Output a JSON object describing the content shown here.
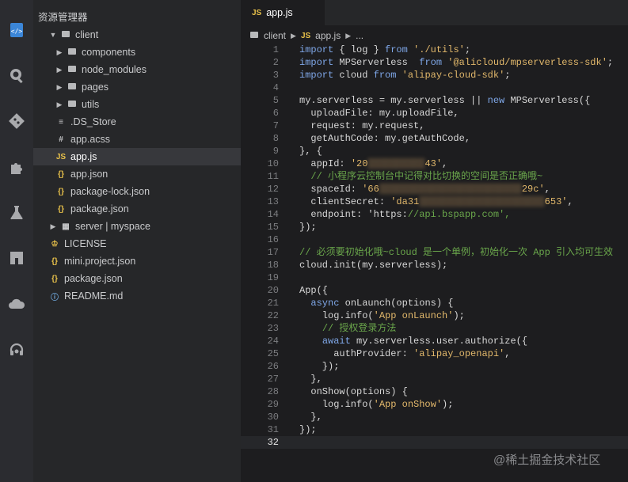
{
  "activity_bar": {
    "icons": [
      "code-icon",
      "search-icon",
      "git-icon",
      "extensions-icon",
      "test-flask-icon",
      "layout-icon",
      "cloud-icon",
      "support-headset-icon"
    ]
  },
  "explorer": {
    "title": "资源管理器",
    "items": [
      {
        "label": "client",
        "type": "folder-open"
      },
      {
        "label": "components",
        "type": "folder"
      },
      {
        "label": "node_modules",
        "type": "folder"
      },
      {
        "label": "pages",
        "type": "folder"
      },
      {
        "label": "utils",
        "type": "folder"
      },
      {
        "label": ".DS_Store",
        "type": "file",
        "icon": "≡"
      },
      {
        "label": "app.acss",
        "type": "file",
        "icon": "#"
      },
      {
        "label": "app.js",
        "type": "file",
        "icon": "JS"
      },
      {
        "label": "app.json",
        "type": "file",
        "icon": "{}"
      },
      {
        "label": "package-lock.json",
        "type": "file",
        "icon": "{}"
      },
      {
        "label": "package.json",
        "type": "file",
        "icon": "{}"
      },
      {
        "label": "server | myspace",
        "type": "folder-server"
      },
      {
        "label": "LICENSE",
        "type": "file",
        "icon": "♔"
      },
      {
        "label": "mini.project.json",
        "type": "file",
        "icon": "{}"
      },
      {
        "label": "package.json",
        "type": "file",
        "icon": "{}"
      },
      {
        "label": "README.md",
        "type": "file",
        "icon": "ⓘ"
      }
    ],
    "selected": "app.js"
  },
  "tab": {
    "badge": "JS",
    "label": "app.js"
  },
  "breadcrumb": {
    "folder": "client",
    "badge": "JS",
    "file": "app.js",
    "more": "..."
  },
  "code": {
    "current_line": 32,
    "lines": [
      {
        "n": "1",
        "t": "import { log } from './utils';"
      },
      {
        "n": "2",
        "t": "import MPServerless  from '@alicloud/mpserverless-sdk';"
      },
      {
        "n": "3",
        "t": "import cloud from 'alipay-cloud-sdk';"
      },
      {
        "n": "4",
        "t": ""
      },
      {
        "n": "5",
        "t": "my.serverless = my.serverless || new MPServerless({"
      },
      {
        "n": "6",
        "t": "  uploadFile: my.uploadFile,"
      },
      {
        "n": "7",
        "t": "  request: my.request,"
      },
      {
        "n": "8",
        "t": "  getAuthCode: my.getAuthCode,"
      },
      {
        "n": "9",
        "t": "}, {"
      },
      {
        "n": "10",
        "t": "  appId: '20▒▒▒▒▒▒▒▒▒▒43',"
      },
      {
        "n": "11",
        "t": "  // 小程序云控制台中记得对比切换的空间是否正确哦~"
      },
      {
        "n": "12",
        "t": "  spaceId: '66▒▒▒▒▒▒▒▒▒▒▒▒▒▒▒▒▒▒▒▒▒▒▒▒▒29c',"
      },
      {
        "n": "13",
        "t": "  clientSecret: 'da31▒▒▒▒▒▒▒▒▒▒▒▒▒▒▒▒▒▒▒▒▒▒653',"
      },
      {
        "n": "14",
        "t": "  endpoint: 'https://api.bspapp.com',"
      },
      {
        "n": "15",
        "t": "});"
      },
      {
        "n": "16",
        "t": ""
      },
      {
        "n": "17",
        "t": "// 必须要初始化哦~cloud 是一个单例，初始化一次 App 引入均可生效"
      },
      {
        "n": "18",
        "t": "cloud.init(my.serverless);"
      },
      {
        "n": "19",
        "t": ""
      },
      {
        "n": "20",
        "t": "App({"
      },
      {
        "n": "21",
        "t": "  async onLaunch(options) {"
      },
      {
        "n": "22",
        "t": "    log.info('App onLaunch');"
      },
      {
        "n": "23",
        "t": "    // 授权登录方法"
      },
      {
        "n": "24",
        "t": "    await my.serverless.user.authorize({"
      },
      {
        "n": "25",
        "t": "      authProvider: 'alipay_openapi',"
      },
      {
        "n": "26",
        "t": "    });"
      },
      {
        "n": "27",
        "t": "  },"
      },
      {
        "n": "28",
        "t": "  onShow(options) {"
      },
      {
        "n": "29",
        "t": "    log.info('App onShow');"
      },
      {
        "n": "30",
        "t": "  },"
      },
      {
        "n": "31",
        "t": "});"
      },
      {
        "n": "32",
        "t": ""
      }
    ]
  },
  "watermark": "@稀土掘金技术社区",
  "colors": {
    "js_badge": "#e8c14a",
    "string": "#e2b86b",
    "comment": "#6aa64b",
    "keyword": "#7fa7e8"
  }
}
